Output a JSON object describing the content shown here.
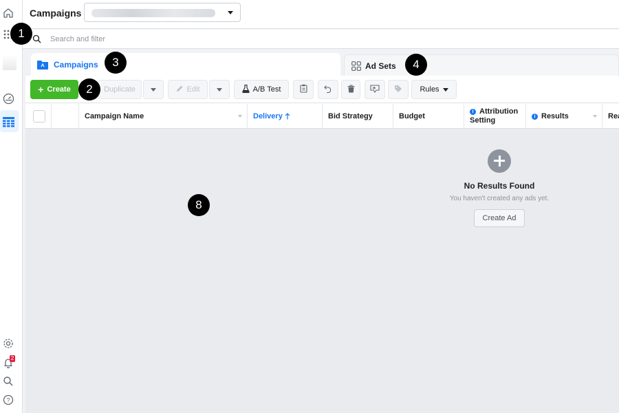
{
  "topbar": {
    "title": "Campaigns"
  },
  "search": {
    "placeholder": "Search and filter",
    "value": ""
  },
  "tabs": [
    {
      "label": "Campaigns",
      "active": true
    },
    {
      "label": "Ad Sets",
      "active": false
    }
  ],
  "toolbar": {
    "create_label": "Create",
    "duplicate_label": "Duplicate",
    "edit_label": "Edit",
    "ab_test_label": "A/B Test",
    "rules_label": "Rules"
  },
  "columns": {
    "campaign_name": "Campaign Name",
    "delivery": "Delivery",
    "bid_strategy": "Bid Strategy",
    "budget": "Budget",
    "attribution_line1": "Attribution",
    "attribution_line2": "Setting",
    "results": "Results",
    "reach": "Rea"
  },
  "empty_state": {
    "title": "No Results Found",
    "subtitle": "You haven't created any ads yet.",
    "button_label": "Create Ad"
  },
  "notifications": {
    "count": "2"
  },
  "markers": [
    "1",
    "2",
    "3",
    "4",
    "8"
  ],
  "colors": {
    "accent": "#1877f2",
    "create_green": "#42b72a",
    "badge_red": "#e41e3f"
  }
}
